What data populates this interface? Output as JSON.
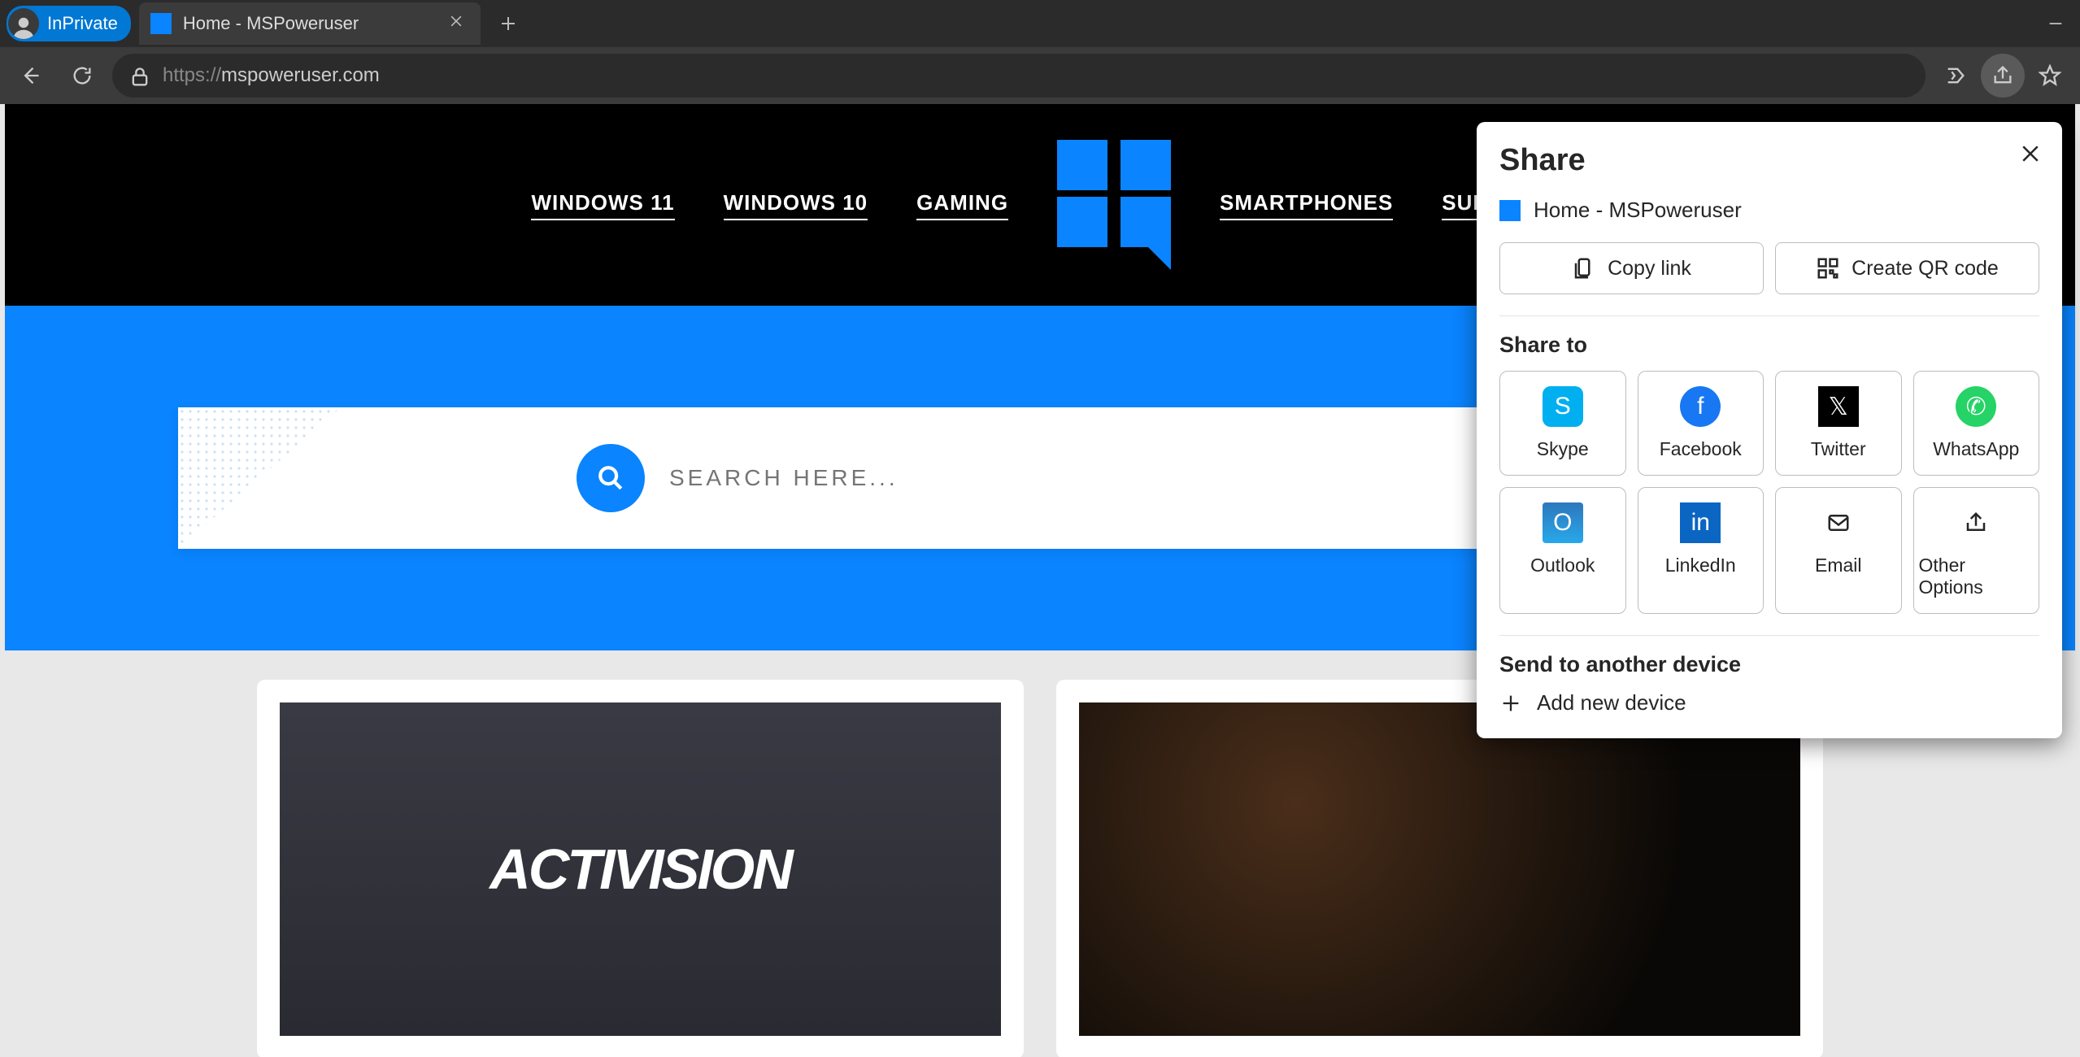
{
  "titlebar": {
    "inprivate_label": "InPrivate",
    "tab_title": "Home - MSPoweruser"
  },
  "addressbar": {
    "protocol": "https://",
    "host": "mspoweruser.com"
  },
  "site_nav": {
    "items": [
      "WINDOWS 11",
      "WINDOWS 10",
      "GAMING",
      "SMARTPHONES",
      "SURFACE"
    ]
  },
  "search": {
    "placeholder": "SEARCH HERE..."
  },
  "cards": {
    "items": [
      {
        "thumb_label": "ACTIVISION"
      },
      {
        "thumb_label": ""
      }
    ]
  },
  "share_panel": {
    "title": "Share",
    "page_title": "Home - MSPoweruser",
    "copy_link_label": "Copy link",
    "qr_label": "Create QR code",
    "share_to_label": "Share to",
    "targets": [
      "Skype",
      "Facebook",
      "Twitter",
      "WhatsApp",
      "Outlook",
      "LinkedIn",
      "Email",
      "Other Options"
    ],
    "send_label": "Send to another device",
    "add_device_label": "Add new device"
  }
}
